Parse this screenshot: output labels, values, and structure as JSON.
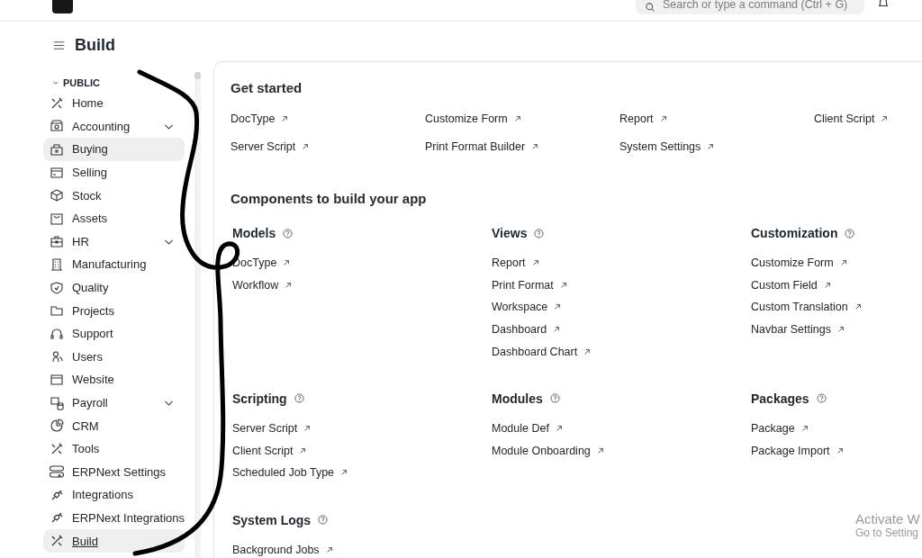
{
  "topbar": {
    "search": {
      "placeholder": "Search or type a command (Ctrl + G)"
    }
  },
  "page": {
    "title": "Build"
  },
  "sidebar": {
    "section": "PUBLIC",
    "items": [
      {
        "label": "Home",
        "expandable": false,
        "selected": false,
        "hovered": false
      },
      {
        "label": "Accounting",
        "expandable": true,
        "selected": false,
        "hovered": false
      },
      {
        "label": "Buying",
        "expandable": false,
        "selected": false,
        "hovered": true
      },
      {
        "label": "Selling",
        "expandable": false,
        "selected": false,
        "hovered": false
      },
      {
        "label": "Stock",
        "expandable": false,
        "selected": false,
        "hovered": false
      },
      {
        "label": "Assets",
        "expandable": false,
        "selected": false,
        "hovered": false
      },
      {
        "label": "HR",
        "expandable": true,
        "selected": false,
        "hovered": false
      },
      {
        "label": "Manufacturing",
        "expandable": false,
        "selected": false,
        "hovered": false
      },
      {
        "label": "Quality",
        "expandable": false,
        "selected": false,
        "hovered": false
      },
      {
        "label": "Projects",
        "expandable": false,
        "selected": false,
        "hovered": false
      },
      {
        "label": "Support",
        "expandable": false,
        "selected": false,
        "hovered": false
      },
      {
        "label": "Users",
        "expandable": false,
        "selected": false,
        "hovered": false
      },
      {
        "label": "Website",
        "expandable": false,
        "selected": false,
        "hovered": false
      },
      {
        "label": "Payroll",
        "expandable": true,
        "selected": false,
        "hovered": false
      },
      {
        "label": "CRM",
        "expandable": false,
        "selected": false,
        "hovered": false
      },
      {
        "label": "Tools",
        "expandable": false,
        "selected": false,
        "hovered": false
      },
      {
        "label": "ERPNext Settings",
        "expandable": false,
        "selected": false,
        "hovered": false
      },
      {
        "label": "Integrations",
        "expandable": false,
        "selected": false,
        "hovered": false
      },
      {
        "label": "ERPNext Integrations",
        "expandable": false,
        "selected": false,
        "hovered": false
      },
      {
        "label": "Build",
        "expandable": false,
        "selected": true,
        "hovered": false
      }
    ]
  },
  "get_started": {
    "title": "Get started",
    "links": [
      "DocType",
      "Customize Form",
      "Report",
      "Client Script",
      "Server Script",
      "Print Format Builder",
      "System Settings"
    ]
  },
  "components": {
    "title": "Components to build your app",
    "groups": [
      {
        "title": "Models",
        "links": [
          "DocType",
          "Workflow"
        ]
      },
      {
        "title": "Views",
        "links": [
          "Report",
          "Print Format",
          "Workspace",
          "Dashboard",
          "Dashboard Chart"
        ]
      },
      {
        "title": "Customization",
        "links": [
          "Customize Form",
          "Custom Field",
          "Custom Translation",
          "Navbar Settings"
        ]
      },
      {
        "title": "Scripting",
        "links": [
          "Server Script",
          "Client Script",
          "Scheduled Job Type"
        ]
      },
      {
        "title": "Modules",
        "links": [
          "Module Def",
          "Module Onboarding"
        ]
      },
      {
        "title": "Packages",
        "links": [
          "Package",
          "Package Import"
        ]
      },
      {
        "title": "System Logs",
        "links": [
          "Background Jobs"
        ]
      }
    ]
  },
  "os_notice": {
    "title": "Activate W",
    "subtitle": "Go to Setting"
  }
}
